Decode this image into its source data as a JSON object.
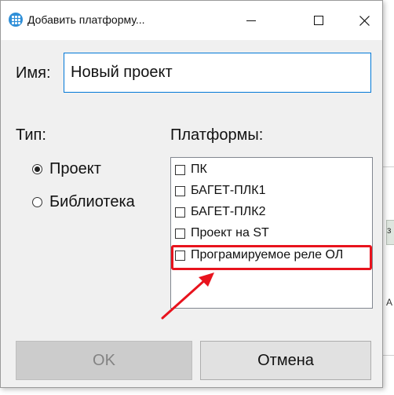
{
  "window": {
    "title": "Добавить платформу..."
  },
  "form": {
    "name_label": "Имя:",
    "name_value": "Новый проект",
    "type_label": "Тип:",
    "platforms_label": "Платформы:"
  },
  "type_options": [
    {
      "label": "Проект",
      "checked": true
    },
    {
      "label": "Библиотека",
      "checked": false
    }
  ],
  "platforms": [
    {
      "label": "ПК",
      "checked": false
    },
    {
      "label": "БАГЕТ-ПЛК1",
      "checked": false
    },
    {
      "label": "БАГЕТ-ПЛК2",
      "checked": false
    },
    {
      "label": "Проект на ST",
      "checked": false
    },
    {
      "label": "Програмируемое реле ОЛ",
      "checked": false
    }
  ],
  "buttons": {
    "ok": "OK",
    "cancel": "Отмена"
  },
  "background": {
    "fragment_1": "з",
    "fragment_2": "А"
  },
  "colors": {
    "annotation_red": "#e8131d",
    "focus_blue": "#0078d7"
  }
}
